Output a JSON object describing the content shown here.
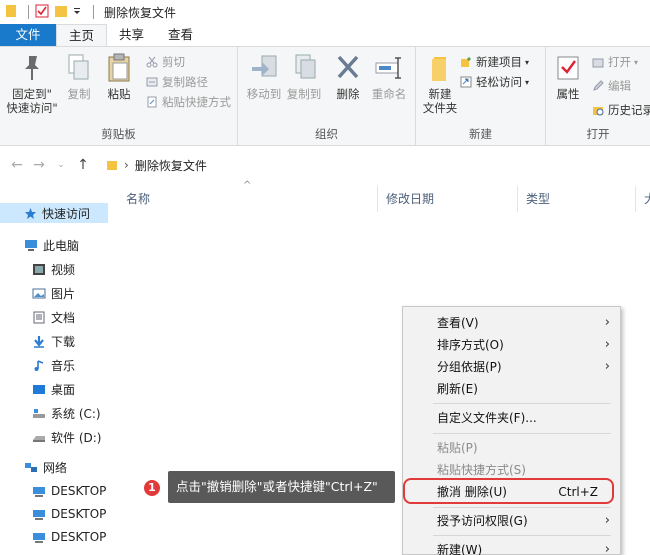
{
  "window": {
    "title": "删除恢复文件"
  },
  "tabs": [
    {
      "label": "文件"
    },
    {
      "label": "主页"
    },
    {
      "label": "共享"
    },
    {
      "label": "查看"
    }
  ],
  "ribbon": {
    "clipboard": {
      "label": "剪贴板",
      "pin": "固定到\"\n快速访问\"",
      "pin_line1": "固定到\"",
      "pin_line2": "快速访问\"",
      "copy": "复制",
      "paste": "粘贴",
      "cut": "剪切",
      "copy_path": "复制路径",
      "paste_shortcut": "粘贴快捷方式"
    },
    "organize": {
      "label": "组织",
      "move_to": "移动到",
      "copy_to": "复制到",
      "delete": "删除",
      "rename": "重命名"
    },
    "new": {
      "label": "新建",
      "new_folder_line1": "新建",
      "new_folder_line2": "文件夹",
      "new_item": "新建项目",
      "easy_access": "轻松访问"
    },
    "open": {
      "label": "打开",
      "properties": "属性",
      "open": "打开",
      "edit": "编辑",
      "history": "历史记录"
    }
  },
  "address": {
    "path": "删除恢复文件"
  },
  "columns": [
    "名称",
    "修改日期",
    "类型",
    "大"
  ],
  "nav": {
    "quick_access": "快速访问",
    "this_pc": "此电脑",
    "items": [
      "视频",
      "图片",
      "文档",
      "下载",
      "音乐",
      "桌面",
      "系统 (C:)",
      "软件 (D:)"
    ],
    "network": "网络",
    "desktops": [
      "DESKTOP",
      "DESKTOP",
      "DESKTOP"
    ]
  },
  "context_menu": {
    "view": "查看(V)",
    "sort": "排序方式(O)",
    "group": "分组依据(P)",
    "refresh": "刷新(E)",
    "customize": "自定义文件夹(F)...",
    "paste": "粘贴(P)",
    "paste_shortcut": "粘贴快捷方式(S)",
    "undo": "撤消 删除(U)",
    "undo_shortcut": "Ctrl+Z",
    "grant": "授予访问权限(G)",
    "new": "新建(W)"
  },
  "callout": {
    "number": "1",
    "text": "点击\"撤销删除\"或者快捷键\"Ctrl+Z\""
  },
  "colors": {
    "accent": "#1979ca",
    "highlight": "#e13a3a",
    "folder": "#f5c342"
  }
}
